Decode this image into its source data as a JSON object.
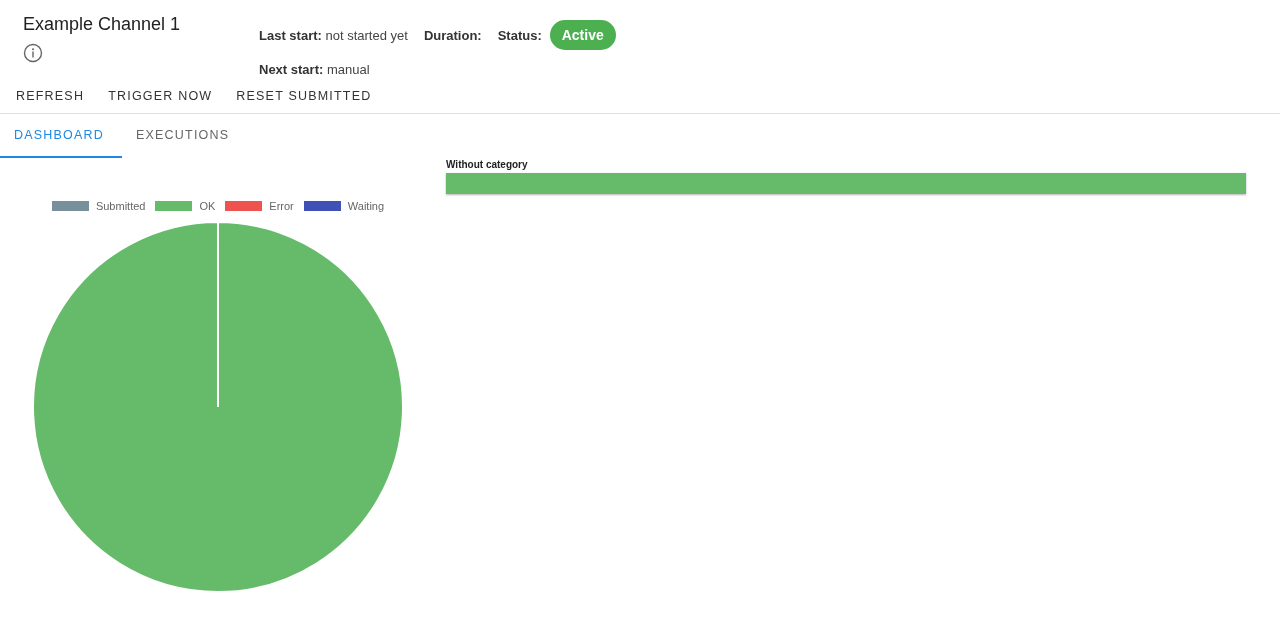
{
  "header": {
    "title": "Example Channel 1",
    "last_start_label": "Last start:",
    "last_start": "not started yet",
    "duration_label": "Duration:",
    "status_label": "Status:",
    "status": "Active",
    "next_start_label": "Next start:",
    "next_start": "manual"
  },
  "actions": [
    "REFRESH",
    "TRIGGER NOW",
    "RESET SUBMITTED"
  ],
  "tabs": [
    {
      "label": "DASHBOARD",
      "selected": true
    },
    {
      "label": "EXECUTIONS",
      "selected": false
    }
  ],
  "pie": {
    "chart_data": {
      "type": "pie",
      "categories": [
        "Submitted",
        "OK",
        "Error",
        "Waiting"
      ],
      "values": [
        0,
        1,
        0,
        0
      ],
      "colors": [
        "#78909c",
        "#66bb6a",
        "#ef5350",
        "#3f51b5"
      ]
    }
  },
  "categories": [
    {
      "label": "Without category",
      "color": "#66bb6a"
    }
  ]
}
